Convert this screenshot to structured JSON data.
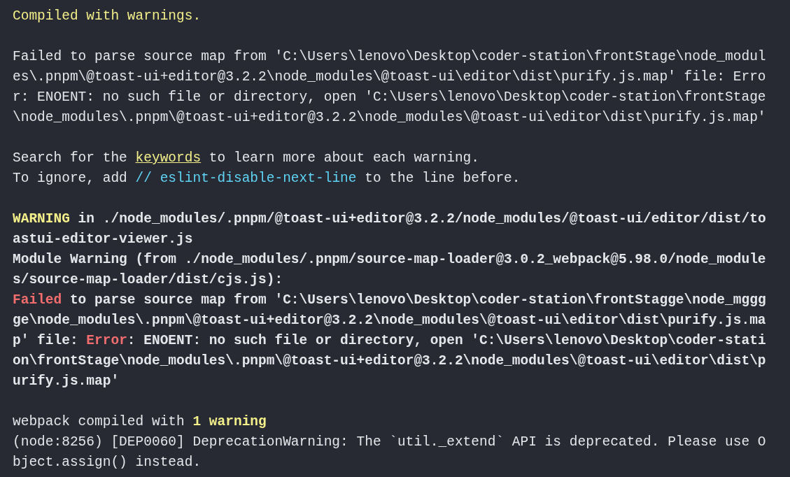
{
  "terminal": {
    "blocks": [
      {
        "bold": false,
        "lines": [
          [
            {
              "text": "Compiled with warnings.",
              "kind": "yellow"
            }
          ]
        ]
      },
      {
        "bold": false,
        "lines": [
          [
            {
              "text": "Failed to parse source map from 'C:\\Users\\lenovo\\Desktop\\coder-station\\frontStage\\node_modul",
              "kind": "plain"
            }
          ],
          [
            {
              "text": "es\\.pnpm\\@toast-ui+editor@3.2.2\\node_modules\\@toast-ui\\editor\\dist\\purify.js.map' file: Erro",
              "kind": "plain"
            }
          ],
          [
            {
              "text": "r: ENOENT: no such file or directory, open 'C:\\Users\\lenovo\\Desktop\\coder-station\\frontStage",
              "kind": "plain"
            }
          ],
          [
            {
              "text": "\\node_modules\\.pnpm\\@toast-ui+editor@3.2.2\\node_modules\\@toast-ui\\editor\\dist\\purify.js.map'",
              "kind": "plain"
            }
          ]
        ]
      },
      {
        "bold": false,
        "lines": [
          [
            {
              "text": "Search for the ",
              "kind": "plain"
            },
            {
              "text": "keywords",
              "kind": "keyword"
            },
            {
              "text": " to learn more about each warning.",
              "kind": "plain"
            }
          ],
          [
            {
              "text": "To ignore, add ",
              "kind": "plain"
            },
            {
              "text": "// eslint-disable-next-line",
              "kind": "cyan"
            },
            {
              "text": " to the line before.",
              "kind": "plain"
            }
          ]
        ]
      },
      {
        "bold": true,
        "lines": [
          [
            {
              "text": "WARNING",
              "kind": "yellow"
            },
            {
              "text": " in ./node_modules/.pnpm/@toast-ui+editor@3.2.2/node_modules/@toast-ui/editor/dist/to",
              "kind": "plain"
            }
          ],
          [
            {
              "text": "astui-editor-viewer.js",
              "kind": "plain"
            }
          ],
          [
            {
              "text": "Module Warning (from ./node_modules/.pnpm/source-map-loader@3.0.2_webpack@5.98.0/node_module",
              "kind": "plain"
            }
          ],
          [
            {
              "text": "s/source-map-loader/dist/cjs.js):",
              "kind": "plain"
            }
          ],
          [
            {
              "text": "Failed",
              "kind": "red"
            },
            {
              "text": " to parse source map from 'C:\\Users\\lenovo\\Desktop\\coder-station\\frontStagge\\node_mggg",
              "kind": "plain"
            }
          ],
          [
            {
              "text": "ge\\node_modules\\.pnpm\\@toast-ui+editor@3.2.2\\node_modules\\@toast-ui\\editor\\dist\\purify.js.ma",
              "kind": "plain"
            }
          ],
          [
            {
              "text": "p' file: ",
              "kind": "plain"
            },
            {
              "text": "Error",
              "kind": "red"
            },
            {
              "text": ": ENOENT: no such file or directory, open 'C:\\Users\\lenovo\\Desktop\\coder-stati",
              "kind": "plain"
            }
          ],
          [
            {
              "text": "on\\frontStage\\node_modules\\.pnpm\\@toast-ui+editor@3.2.2\\node_modules\\@toast-ui\\editor\\dist\\p",
              "kind": "plain"
            }
          ],
          [
            {
              "text": "urify.js.map'",
              "kind": "plain"
            }
          ]
        ]
      },
      {
        "bold": false,
        "lines": [
          [
            {
              "text": "webpack compiled with ",
              "kind": "plain"
            },
            {
              "text": "1 warning",
              "kind": "bold-yellow"
            }
          ],
          [
            {
              "text": "(node:8256) [DEP0060] DeprecationWarning: The `util._extend` API is deprecated. Please use O",
              "kind": "plain"
            }
          ],
          [
            {
              "text": "bject.assign() instead.",
              "kind": "plain"
            }
          ]
        ]
      }
    ]
  }
}
